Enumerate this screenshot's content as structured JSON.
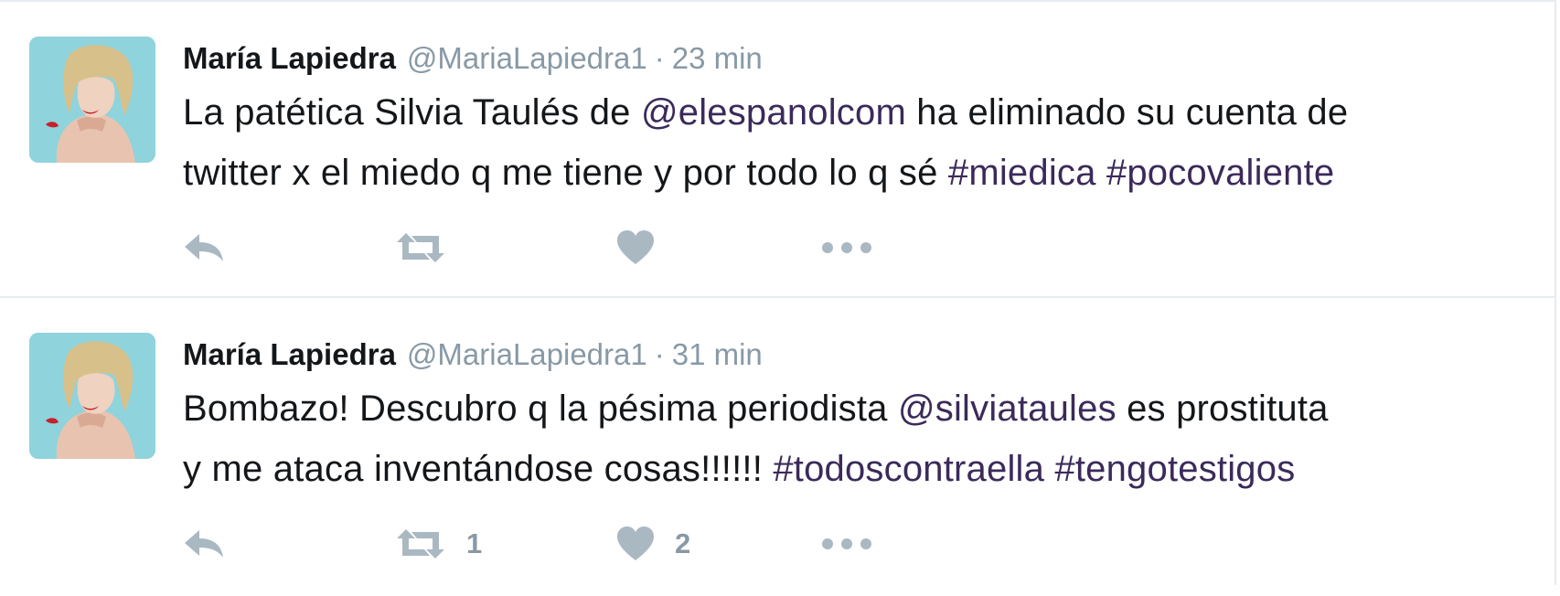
{
  "tweets": [
    {
      "name": "María Lapiedra",
      "handle": "@MariaLapiedra1",
      "separator": "·",
      "time": "23 min",
      "text_lines": [
        [
          {
            "text": "La patética Silvia Taulés de ",
            "kind": "plain"
          },
          {
            "text": "@elespanolcom",
            "kind": "mention"
          },
          {
            "text": " ha eliminado su cuenta de",
            "kind": "plain"
          }
        ],
        [
          {
            "text": "twitter x el miedo q me tiene y por todo lo q sé ",
            "kind": "plain"
          },
          {
            "text": "#miedica",
            "kind": "hashtag"
          },
          {
            "text": " ",
            "kind": "plain"
          },
          {
            "text": "#pocovaliente",
            "kind": "hashtag"
          }
        ]
      ],
      "actions": {
        "reply_icon": "reply-icon",
        "retweet_icon": "retweet-icon",
        "retweet_count": "",
        "like_icon": "heart-icon",
        "like_count": "",
        "more_icon": "more-dots-icon"
      }
    },
    {
      "name": "María Lapiedra",
      "handle": "@MariaLapiedra1",
      "separator": "·",
      "time": "31 min",
      "text_lines": [
        [
          {
            "text": "Bombazo! Descubro q la pésima periodista ",
            "kind": "plain"
          },
          {
            "text": "@silviataules",
            "kind": "mention"
          },
          {
            "text": " es prostituta",
            "kind": "plain"
          }
        ],
        [
          {
            "text": "y me ataca inventándose cosas!!!!!! ",
            "kind": "plain"
          },
          {
            "text": "#todoscontraella",
            "kind": "hashtag"
          },
          {
            "text": " ",
            "kind": "plain"
          },
          {
            "text": "#tengotestigos",
            "kind": "hashtag"
          }
        ]
      ],
      "actions": {
        "reply_icon": "reply-icon",
        "retweet_icon": "retweet-icon",
        "retweet_count": "1",
        "like_icon": "heart-icon",
        "like_count": "2",
        "more_icon": "more-dots-icon"
      }
    }
  ],
  "colors": {
    "name": "#14171a",
    "muted": "#8899a6",
    "icon": "#aab8c2",
    "link": "#3b2a5a",
    "avatar_bg": "#8fd3dc"
  }
}
